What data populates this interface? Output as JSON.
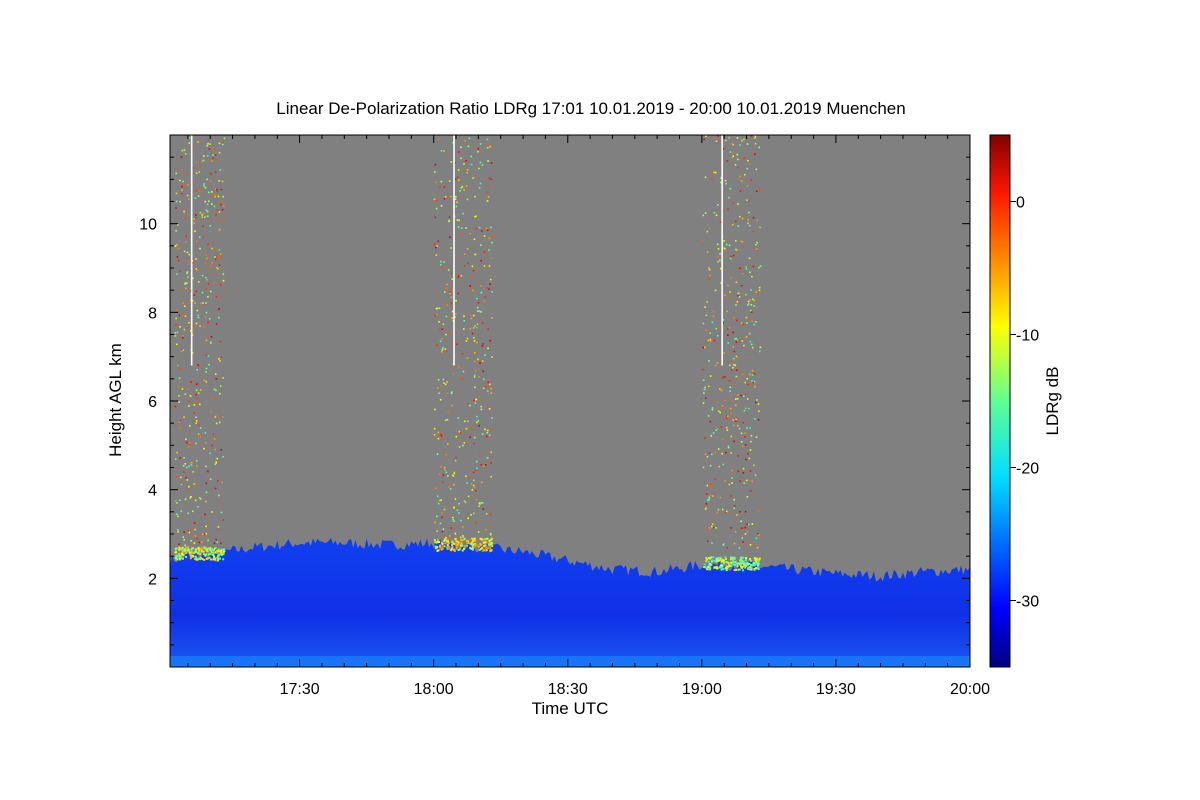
{
  "chart_data": {
    "type": "heatmap",
    "title": "Linear De-Polarization Ratio LDRg   17:01 10.01.2019 - 20:00 10.01.2019 Muenchen",
    "xlabel": "Time UTC",
    "ylabel": "Height AGL km",
    "x_range_minutes_utc": [
      1021,
      1200
    ],
    "x_ticks": [
      {
        "minute": 1050,
        "label": "17:30"
      },
      {
        "minute": 1080,
        "label": "18:00"
      },
      {
        "minute": 1110,
        "label": "18:30"
      },
      {
        "minute": 1140,
        "label": "19:00"
      },
      {
        "minute": 1170,
        "label": "19:30"
      },
      {
        "minute": 1200,
        "label": "20:00"
      }
    ],
    "ylim": [
      0,
      12
    ],
    "y_ticks": [
      {
        "value": 2,
        "label": "2"
      },
      {
        "value": 4,
        "label": "4"
      },
      {
        "value": 6,
        "label": "6"
      },
      {
        "value": 8,
        "label": "8"
      },
      {
        "value": 10,
        "label": "10"
      }
    ],
    "colorbar": {
      "label": "LDRg dB",
      "range": [
        -35,
        5
      ],
      "ticks": [
        {
          "value": 0,
          "label": "0"
        },
        {
          "value": -10,
          "label": "-10"
        },
        {
          "value": -20,
          "label": "-20"
        },
        {
          "value": -30,
          "label": "-30"
        }
      ],
      "colormap": "jet"
    },
    "background_color": "#808080",
    "boundary_layer_top_km": [
      [
        1021,
        2.4
      ],
      [
        1025,
        2.5
      ],
      [
        1030,
        2.55
      ],
      [
        1040,
        2.7
      ],
      [
        1050,
        2.8
      ],
      [
        1060,
        2.8
      ],
      [
        1070,
        2.75
      ],
      [
        1080,
        2.8
      ],
      [
        1090,
        2.7
      ],
      [
        1100,
        2.6
      ],
      [
        1110,
        2.4
      ],
      [
        1120,
        2.2
      ],
      [
        1130,
        2.15
      ],
      [
        1140,
        2.3
      ],
      [
        1150,
        2.3
      ],
      [
        1160,
        2.2
      ],
      [
        1170,
        2.1
      ],
      [
        1180,
        2.05
      ],
      [
        1190,
        2.15
      ],
      [
        1200,
        2.2
      ]
    ],
    "precipitation_streaks": [
      {
        "start_minute": 1022,
        "end_minute": 1033,
        "max_height_km": 12,
        "layer_ldr_db": -12
      },
      {
        "start_minute": 1080,
        "end_minute": 1093,
        "max_height_km": 12,
        "layer_ldr_db": -10
      },
      {
        "start_minute": 1140,
        "end_minute": 1153,
        "max_height_km": 12,
        "layer_ldr_db": -14
      }
    ],
    "boundary_layer_ldr_db": -30
  }
}
